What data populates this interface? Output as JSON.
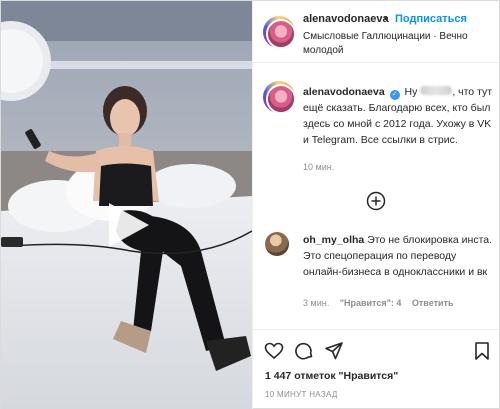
{
  "header": {
    "username": "alenavodonaeva",
    "dot": "•",
    "follow_label": "Подписаться",
    "audio": "Смысловые Галлюцинации · Вечно молодой"
  },
  "caption": {
    "username": "alenavodonaeva",
    "text_before_blur": "Ну",
    "text_after_blur": ", что тут ещё сказать. Благодарю всех, кто был здесь со мной с 2012 года. Ухожу в VK и Telegram. Все ссылки в стрис.",
    "time": "10 мин."
  },
  "comment": {
    "username": "oh_my_olha",
    "text": "Это не блокировка инста. Это спецоперация по переводу онлайн-бизнеса в одноклассники и вк",
    "time": "3 мин.",
    "likes": "\"Нравится\": 4",
    "reply_label": "Ответить"
  },
  "footer": {
    "likes": "1 447 отметок \"Нравится\"",
    "date": "10 МИНУТ НАЗАД"
  },
  "icons": [
    "heart-icon",
    "comment-icon",
    "share-icon",
    "bookmark-icon",
    "plus-circle-icon",
    "play-icon",
    "verified-icon"
  ],
  "colors": {
    "link": "#0095f6",
    "verified": "#3897f0",
    "muted": "#8e8e8e",
    "text": "#262626"
  }
}
